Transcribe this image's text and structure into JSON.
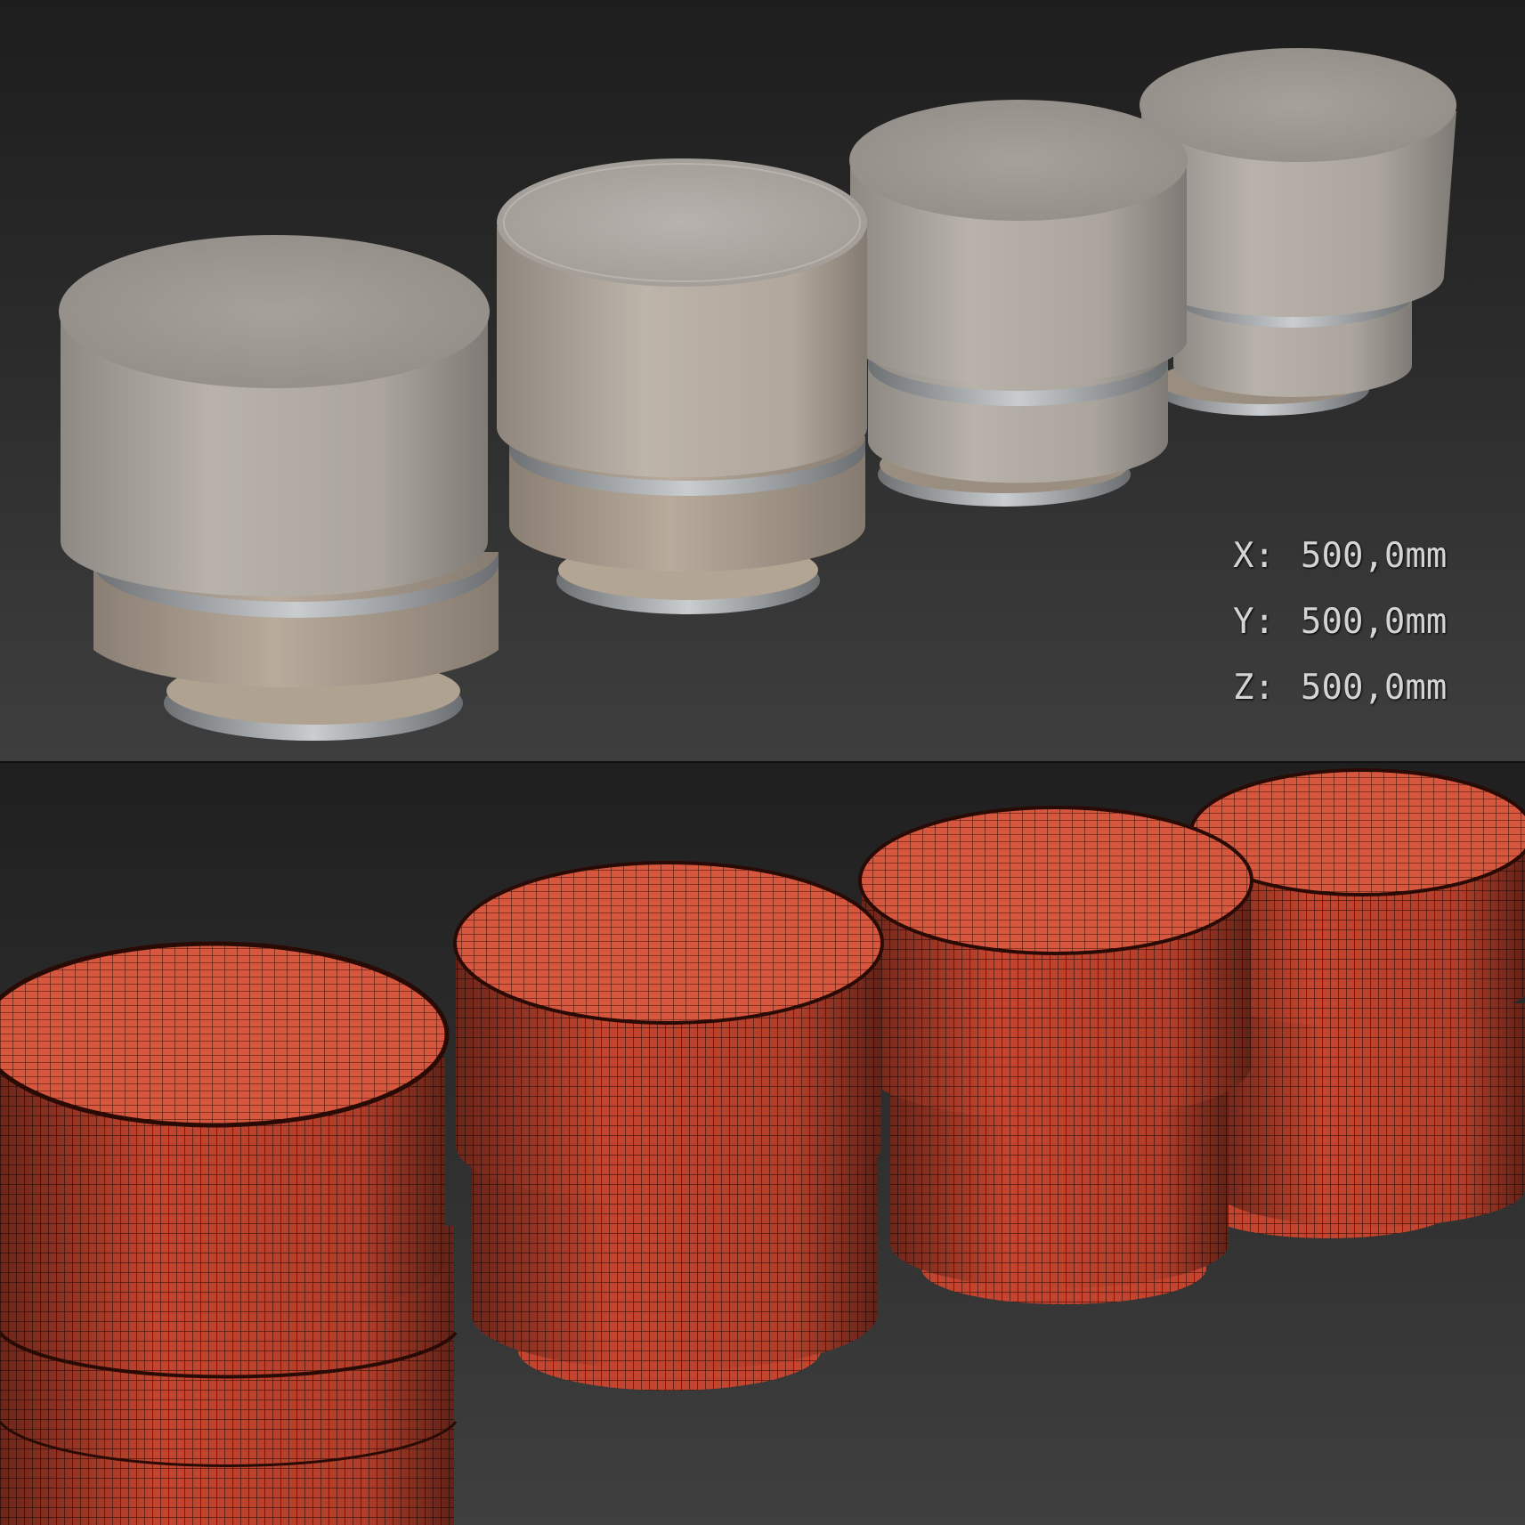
{
  "dimensions": [
    {
      "axis": "X:",
      "value": "500,0mm"
    },
    {
      "axis": "Y:",
      "value": "500,0mm"
    },
    {
      "axis": "Z:",
      "value": "500,0mm"
    }
  ],
  "colors": {
    "background_top": "#1d1d1d",
    "background_bottom": "#3e3e3e",
    "fabric_light": "#b7b1aa",
    "leather_band": "#b9ab9c",
    "metal_ring": "#a9aeb0",
    "wireframe_red": "#c94734",
    "wire_line": "#2a0f0a",
    "label_text": "#d4d4d4"
  }
}
